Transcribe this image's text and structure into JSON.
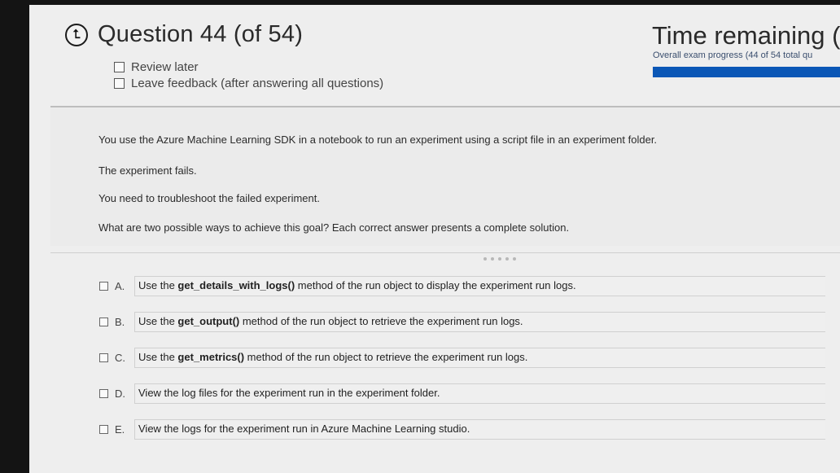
{
  "header": {
    "back_icon": "back-arrow-icon",
    "back_glyph": "⮤",
    "question_title": "Question 44 (of 54)",
    "review_later": "Review later",
    "leave_feedback": "Leave feedback (after answering all questions)",
    "time_remaining": "Time remaining (",
    "progress_text": "Overall exam progress (44 of 54 total qu",
    "progress_color": "#0b57b6"
  },
  "question": {
    "line1": "You use the Azure Machine Learning SDK in a notebook to run an experiment using a script file in an experiment folder.",
    "line2": "The experiment fails.",
    "line3": "You need to troubleshoot the failed experiment.",
    "line4": "What are two possible ways to achieve this goal? Each correct answer presents a complete solution."
  },
  "options": [
    {
      "letter": "A.",
      "pre": "Use the ",
      "bold": "get_details_with_logs()",
      "post": " method of the run object to display the experiment run logs."
    },
    {
      "letter": "B.",
      "pre": "Use the ",
      "bold": "get_output()",
      "post": " method of the run object to retrieve the experiment run logs."
    },
    {
      "letter": "C.",
      "pre": "Use the ",
      "bold": "get_metrics()",
      "post": " method of the run object to retrieve the experiment run logs."
    },
    {
      "letter": "D.",
      "pre": "",
      "bold": "",
      "post": "View the log files for the experiment run in the experiment folder."
    },
    {
      "letter": "E.",
      "pre": "",
      "bold": "",
      "post": "View the logs for the experiment run in Azure Machine Learning studio."
    }
  ]
}
